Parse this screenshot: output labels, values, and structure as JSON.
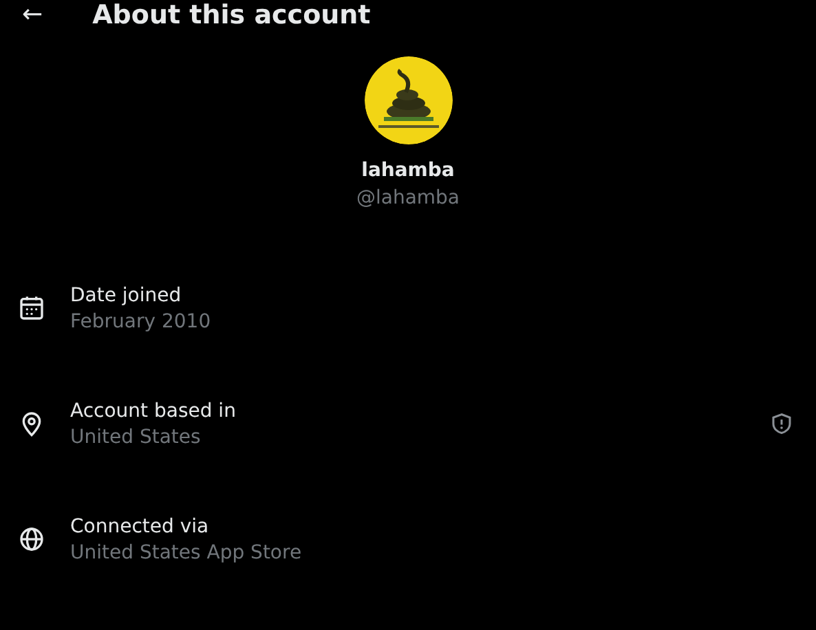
{
  "header": {
    "back": "←",
    "title": "About this account"
  },
  "profile": {
    "name": "lahamba",
    "handle": "@lahamba"
  },
  "rows": [
    {
      "kind": "calendar",
      "label": "Date joined",
      "value": "February 2010",
      "shield": false
    },
    {
      "kind": "location",
      "label": "Account based in",
      "value": "United States",
      "shield": true
    },
    {
      "kind": "globe",
      "label": "Connected via",
      "value": "United States App Store",
      "shield": false
    }
  ]
}
